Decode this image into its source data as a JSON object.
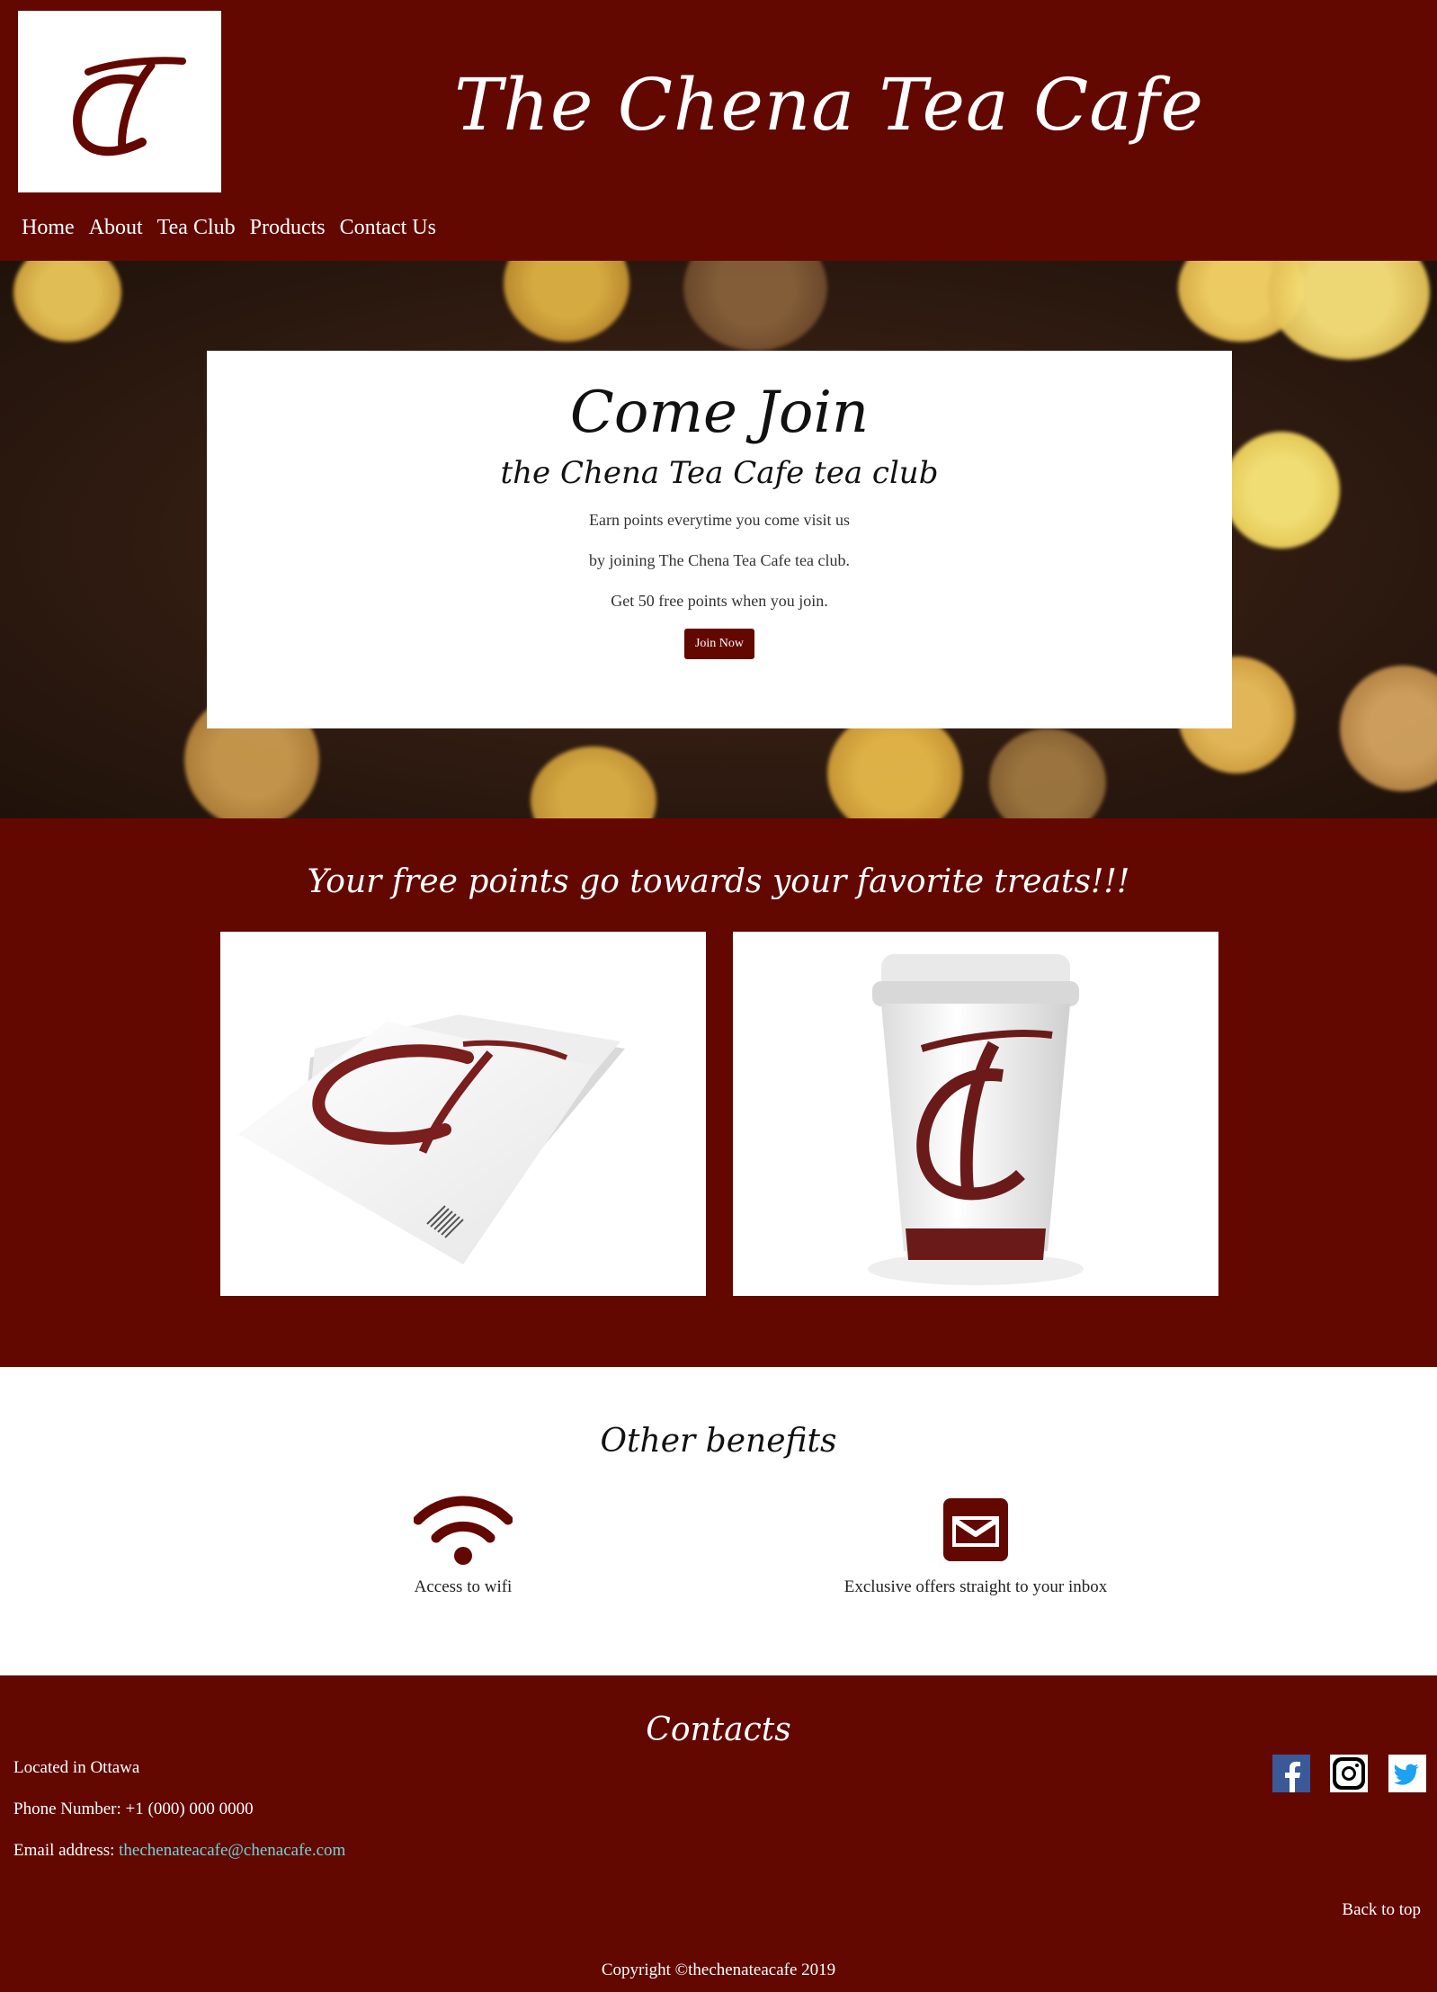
{
  "header": {
    "site_title": "The Chena Tea Cafe",
    "logo_icon": "tc-monogram-logo",
    "nav": [
      "Home",
      "About",
      "Tea Club",
      "Products",
      "Contact Us"
    ]
  },
  "hero": {
    "heading": "Come Join",
    "subheading": "the Chena Tea Cafe tea club",
    "lines": [
      "Earn points everytime you come visit us",
      "by joining The Chena Tea Cafe tea club.",
      "Get 50 free points when you join."
    ],
    "button_label": "Join Now"
  },
  "treats": {
    "title": "Your free points go towards your favorite treats!!!"
  },
  "benefits": {
    "title": "Other benefits",
    "items": [
      {
        "icon": "wifi-icon",
        "label": "Access to wifi"
      },
      {
        "icon": "envelope-icon",
        "label": "Exclusive offers straight to your inbox"
      }
    ]
  },
  "footer": {
    "title": "Contacts",
    "location": "Located in Ottawa",
    "phone": "Phone Number: +1 (000) 000 0000",
    "email_label": "Email address: ",
    "email": "thechenateacafe@chenacafe.com",
    "social": [
      "facebook-icon",
      "instagram-icon",
      "twitter-icon"
    ],
    "back_to_top": "Back to top",
    "copyright": "Copyright ©thechenateacafe 2019"
  },
  "colors": {
    "brand": "#630800",
    "link": "#6fd3d8",
    "white": "#ffffff"
  }
}
